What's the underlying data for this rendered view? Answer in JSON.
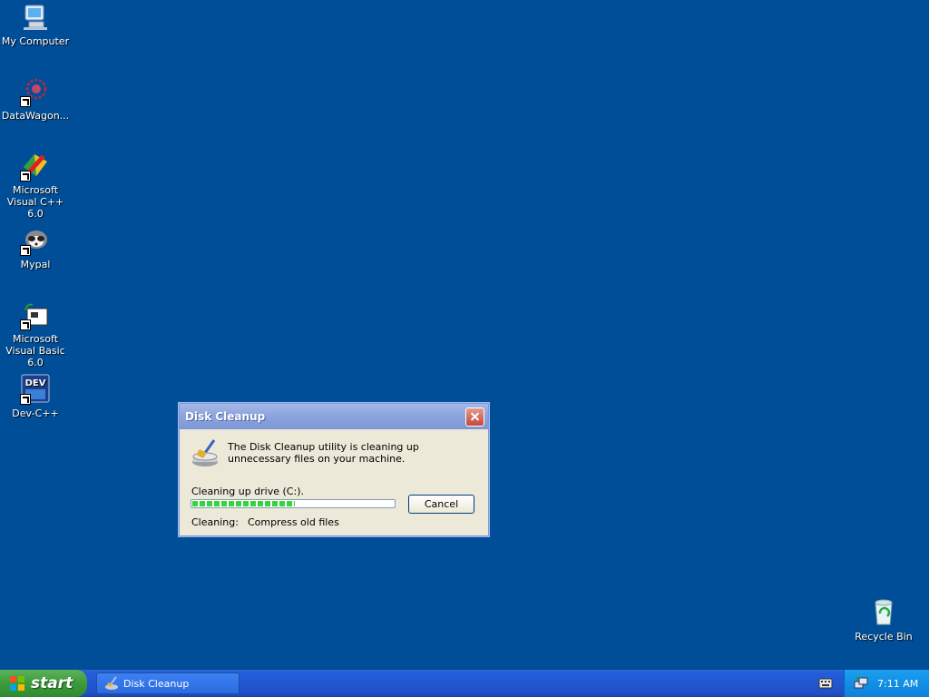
{
  "desktop": {
    "icons": [
      {
        "label": "My Computer"
      },
      {
        "label": "DataWagon..."
      },
      {
        "label": "Microsoft Visual C++ 6.0"
      },
      {
        "label": "Mypal"
      },
      {
        "label": "Microsoft Visual Basic 6.0"
      },
      {
        "label": "Dev-C++",
        "badge": "DEV"
      },
      {
        "label": "Recycle Bin"
      }
    ]
  },
  "dialog": {
    "title": "Disk Cleanup",
    "description": "The Disk Cleanup utility is cleaning up unnecessary files on your machine.",
    "drive_label": "Cleaning up drive  (C:).",
    "progress_percent": 51,
    "cancel_label": "Cancel",
    "cleaning_label": "Cleaning:",
    "cleaning_value": "Compress old files"
  },
  "taskbar": {
    "start_label": "start",
    "task_item_label": "Disk Cleanup",
    "clock": "7:11 AM"
  },
  "colors": {
    "desktop_bg": "#004e98",
    "progress_green": "#37d33a"
  }
}
